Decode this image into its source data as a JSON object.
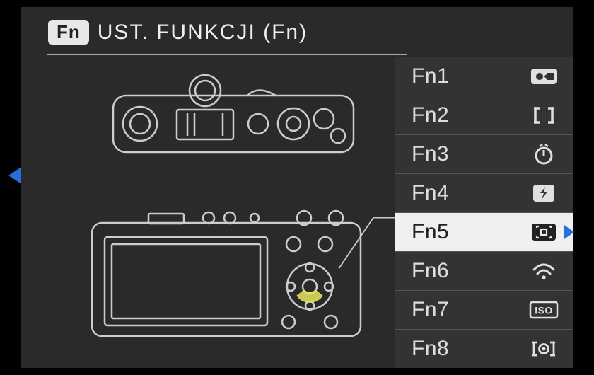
{
  "header": {
    "badge": "Fn",
    "title": "UST. FUNKCJI (Fn)"
  },
  "fn_items": [
    {
      "label": "Fn1",
      "icon": "video-record",
      "selected": false
    },
    {
      "label": "Fn2",
      "icon": "af-area-brackets",
      "selected": false
    },
    {
      "label": "Fn3",
      "icon": "self-timer",
      "selected": false
    },
    {
      "label": "Fn4",
      "icon": "flash",
      "selected": false
    },
    {
      "label": "Fn5",
      "icon": "focus-area",
      "selected": true
    },
    {
      "label": "Fn6",
      "icon": "wifi",
      "selected": false
    },
    {
      "label": "Fn7",
      "icon": "iso",
      "selected": false
    },
    {
      "label": "Fn8",
      "icon": "metering",
      "selected": false
    }
  ],
  "diagram": {
    "top_view": "camera-top-outline",
    "back_view": "camera-back-outline",
    "highlight": "d-pad-down"
  },
  "colors": {
    "bg": "#2a2a2a",
    "text": "#ddd",
    "selected_bg": "#f0f0f0",
    "selected_text": "#222",
    "arrow": "#2a6edb",
    "highlight": "#e8e45a"
  }
}
